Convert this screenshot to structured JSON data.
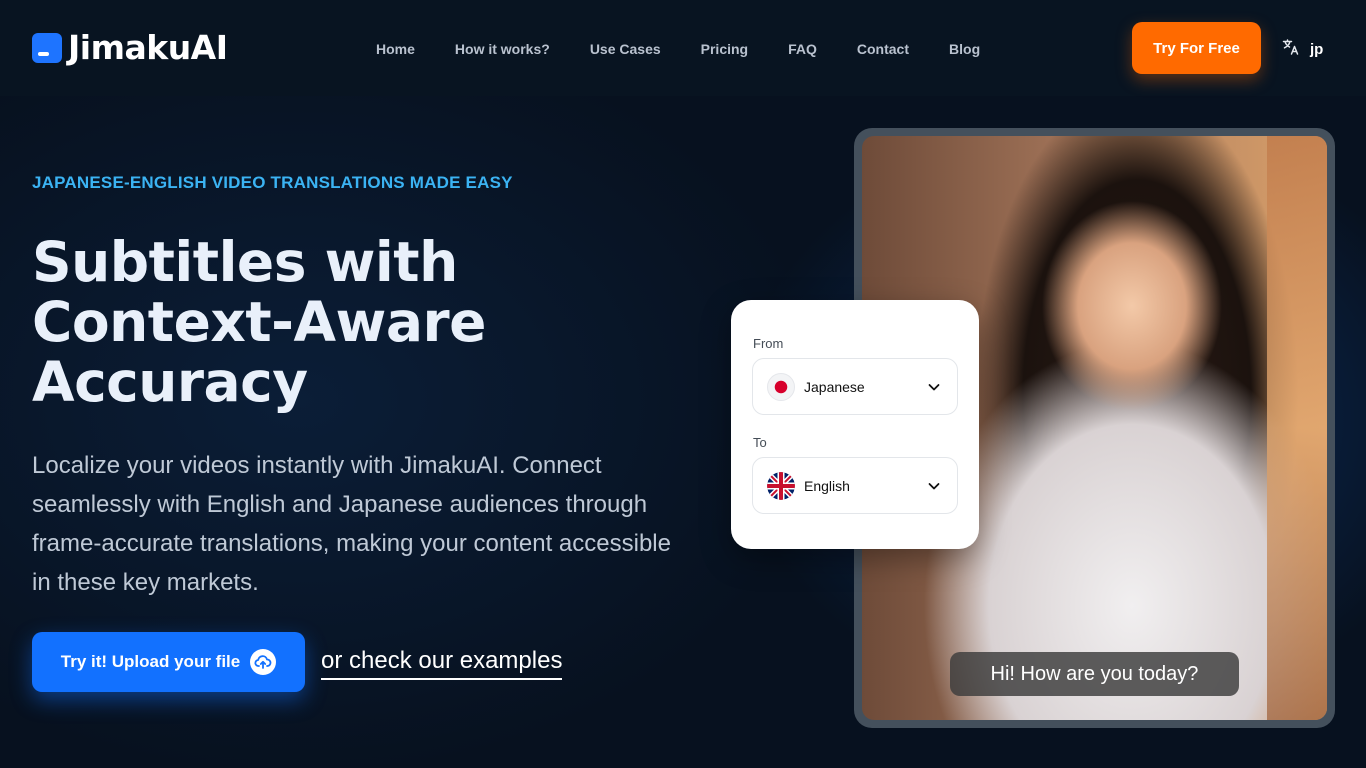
{
  "brand": {
    "name": "JimakuAI"
  },
  "nav": {
    "items": [
      {
        "label": "Home"
      },
      {
        "label": "How it works?"
      },
      {
        "label": "Use Cases"
      },
      {
        "label": "Pricing"
      },
      {
        "label": "FAQ"
      },
      {
        "label": "Contact"
      },
      {
        "label": "Blog"
      }
    ],
    "cta_label": "Try For Free",
    "language_label": "jp"
  },
  "hero": {
    "eyebrow": "JAPANESE-ENGLISH VIDEO TRANSLATIONS MADE EASY",
    "headline_line1": "Subtitles with",
    "headline_line2": "Context-Aware",
    "headline_line3": "Accuracy",
    "description": "Localize your videos instantly with JimakuAI. Connect seamlessly with English and Japanese audiences through frame-accurate translations, making your content accessible in these key markets.",
    "upload_label": "Try it! Upload your file",
    "examples_label": "or check our examples"
  },
  "translator": {
    "from_label": "From",
    "from_value": "Japanese",
    "to_label": "To",
    "to_value": "English"
  },
  "preview": {
    "subtitle": "Hi! How are you today?"
  },
  "colors": {
    "accent_orange": "#ff6a00",
    "accent_blue": "#1271ff",
    "eyebrow_blue": "#3bb3f3",
    "background": "#07111f"
  }
}
